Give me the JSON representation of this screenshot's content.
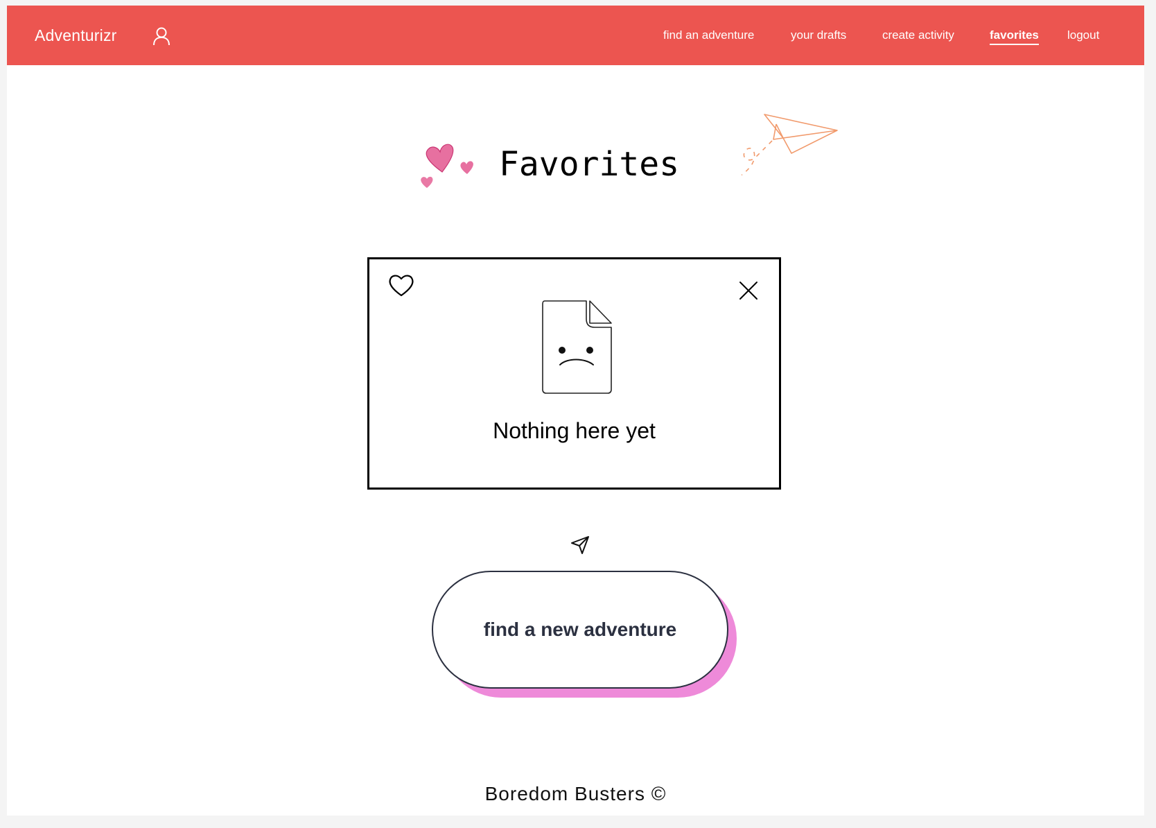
{
  "header": {
    "brand": "Adventurizr",
    "user_icon": "user-icon",
    "nav": [
      {
        "label": "find an adventure",
        "active": false
      },
      {
        "label": "your drafts",
        "active": false
      },
      {
        "label": "create activity",
        "active": false
      },
      {
        "label": "favorites",
        "active": true
      },
      {
        "label": "logout",
        "active": false
      }
    ]
  },
  "main": {
    "title": "Favorites",
    "decorations": [
      "hearts-doodle",
      "paper-plane-doodle"
    ],
    "empty_state": {
      "message": "Nothing here yet",
      "icons": [
        "heart-icon",
        "close-icon",
        "sad-document-icon"
      ]
    },
    "cta": {
      "icon": "send-icon",
      "label": "find a new adventure"
    }
  },
  "footer": {
    "text": "Boredom Busters ©"
  },
  "colors": {
    "navbar": "#ec5550",
    "button_shadow": "#ee8ad9",
    "button_text": "#2b3040",
    "background": "#ffffff"
  }
}
